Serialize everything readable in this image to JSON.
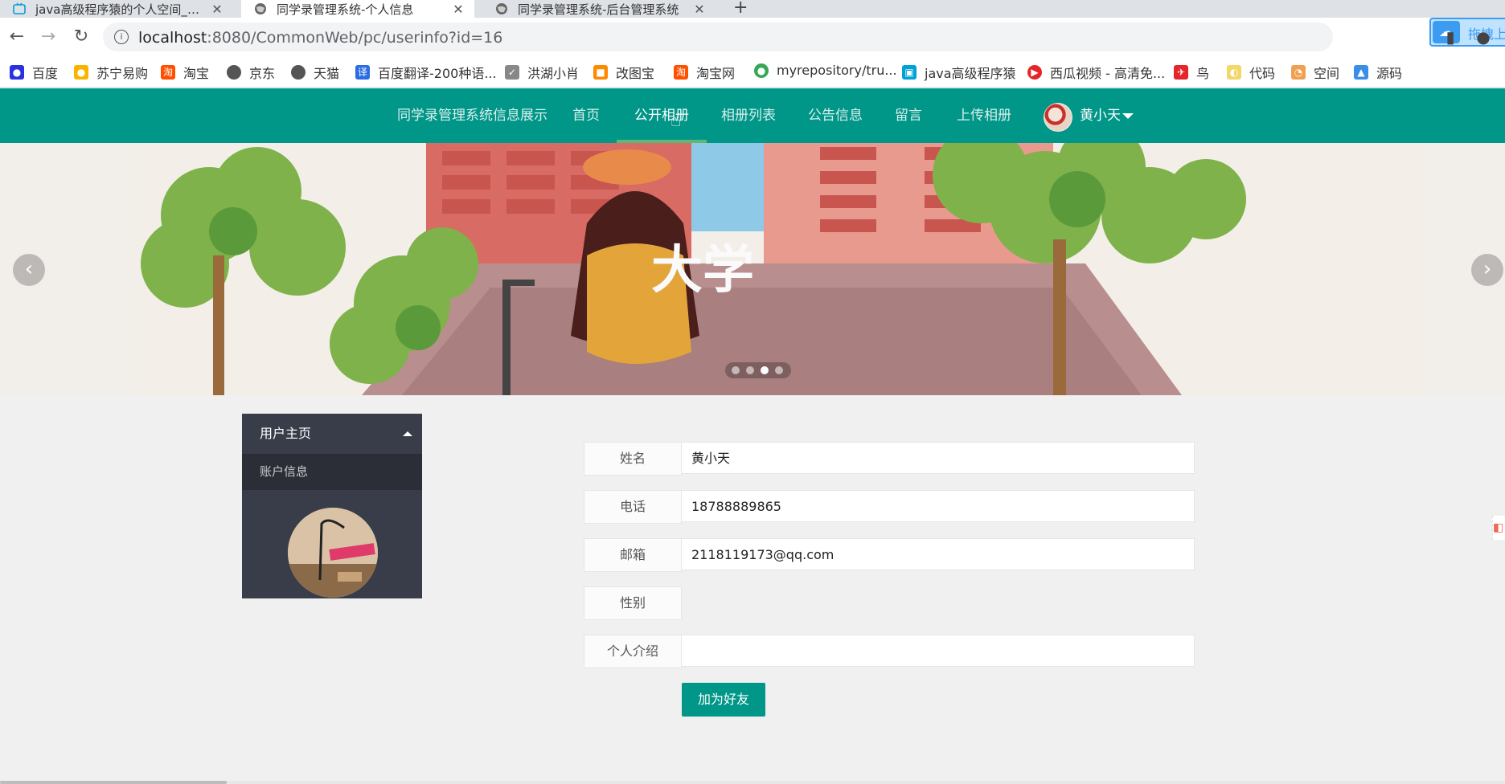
{
  "browser": {
    "tabs": [
      {
        "title": "java高级程序猿的个人空间_哔哩哔哩",
        "active": false
      },
      {
        "title": "同学录管理系统-个人信息",
        "active": true
      },
      {
        "title": "同学录管理系统-后台管理系统",
        "active": false
      }
    ],
    "url_host": "localhost",
    "url_path": ":8080/CommonWeb/pc/userinfo?id=16",
    "upload_label": "拖拽上传",
    "bookmarks": [
      "百度",
      "苏宁易购",
      "淘宝",
      "京东",
      "天猫",
      "百度翻译-200种语...",
      "洪湖小肖",
      "改图宝",
      "淘宝网",
      "myrepository/tru...",
      "java高级程序猿",
      "西瓜视频 - 高清免...",
      "鸟",
      "代码",
      "空间",
      "源码"
    ]
  },
  "site_nav": {
    "items": [
      "同学录管理系统信息展示",
      "首页",
      "公开相册",
      "相册列表",
      "公告信息",
      "留言",
      "上传相册"
    ],
    "active_index": 2,
    "user_name": "黄小天"
  },
  "banner": {
    "text": "大学",
    "slides": 4,
    "active_slide": 2
  },
  "sidebar": {
    "header": "用户主页",
    "item": "账户信息"
  },
  "profile": {
    "fields": [
      {
        "label": "姓名",
        "value": "黄小天"
      },
      {
        "label": "电话",
        "value": "18788889865"
      },
      {
        "label": "邮箱",
        "value": "2118119173@qq.com"
      },
      {
        "label": "性别",
        "value": ""
      },
      {
        "label": "个人介绍",
        "value": ""
      }
    ],
    "add_friend": "加为好友"
  },
  "colors": {
    "primary": "#009688",
    "sidebar": "#393d49"
  }
}
